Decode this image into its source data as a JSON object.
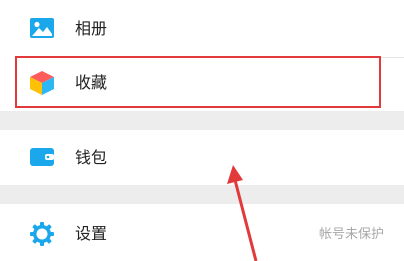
{
  "menu": {
    "album": {
      "label": "相册",
      "icon": "photo-album-icon"
    },
    "favorites": {
      "label": "收藏",
      "icon": "cube-favorites-icon"
    },
    "wallet": {
      "label": "钱包",
      "icon": "wallet-icon"
    },
    "settings": {
      "label": "设置",
      "icon": "gear-icon",
      "hint": "帐号未保护"
    }
  },
  "annotation": {
    "highlight_color": "#e23a3a",
    "arrow_color": "#e23a3a"
  },
  "colors": {
    "accent_blue": "#1aa7ec",
    "gap_gray": "#ededed"
  }
}
